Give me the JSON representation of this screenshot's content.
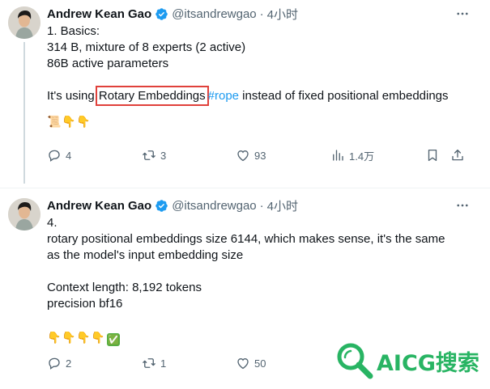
{
  "tweets": [
    {
      "author_name": "Andrew Kean Gao",
      "handle": "@itsandrewgao",
      "separator": "·",
      "time": "4小时",
      "lines": {
        "l1": "1. Basics:",
        "l2": "314 B, mixture of 8 experts (2 active)",
        "l3": "86B active parameters",
        "l4_pre": "It's using ",
        "l4_highlight": "Rotary Embeddings",
        "l4_hashtag": "#rope",
        "l4_post": " instead of fixed positional embeddings"
      },
      "emoji": [
        "📜",
        "👇",
        "👇"
      ],
      "stats": {
        "replies": "4",
        "retweets": "3",
        "likes": "93",
        "views": "1.4万"
      }
    },
    {
      "author_name": "Andrew Kean Gao",
      "handle": "@itsandrewgao",
      "separator": "·",
      "time": "4小时",
      "lines": {
        "l1": "4.",
        "l2": "rotary positional embeddings size 6144, which makes sense, it's the same",
        "l3": "as the model's input embedding size",
        "l4": "Context length: 8,192 tokens",
        "l5": "precision bf16"
      },
      "emoji": [
        "👇",
        "👇",
        "👇",
        "👇",
        "✅"
      ],
      "stats": {
        "replies": "2",
        "retweets": "1",
        "likes": "50"
      }
    }
  ],
  "watermark": {
    "text": "AICG搜索"
  },
  "colors": {
    "accent": "#1d9bf0",
    "highlight_box": "#e0413b",
    "muted": "#536471",
    "watermark": "#28b463"
  }
}
